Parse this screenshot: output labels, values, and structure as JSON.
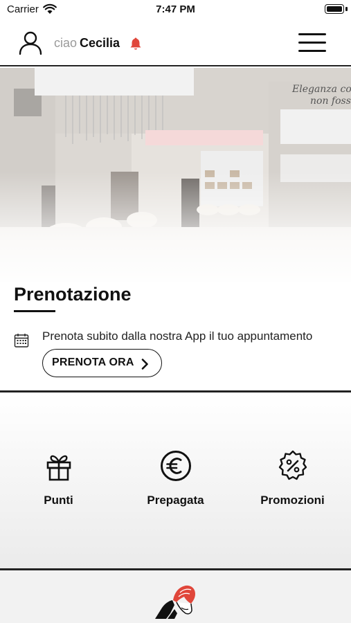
{
  "status_bar": {
    "carrier": "Carrier",
    "time": "7:47 PM"
  },
  "header": {
    "greeting": "ciao",
    "user_name": "Cecilia",
    "icons": [
      "user-icon",
      "bell-icon",
      "hamburger-menu-icon"
    ],
    "accent_color": "#e0463a"
  },
  "booking": {
    "title": "Prenotazione",
    "description": "Prenota subito dalla nostra App il tuo appuntamento",
    "button_label": "PRENOTA ORA",
    "icons": [
      "calendar-icon",
      "chevron-right-icon"
    ]
  },
  "features": {
    "items": [
      {
        "label": "Punti",
        "icon": "gift-icon"
      },
      {
        "label": "Prepagata",
        "icon": "euro-icon"
      },
      {
        "label": "Promozioni",
        "icon": "discount-badge-icon"
      }
    ]
  },
  "footer": {
    "logo": "salon-logo"
  }
}
